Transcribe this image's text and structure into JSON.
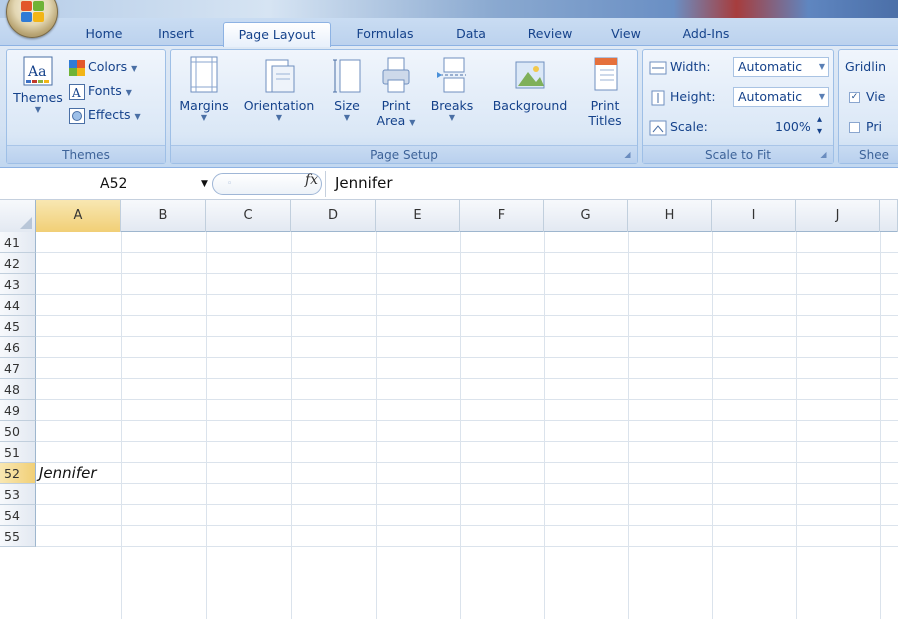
{
  "tabs": [
    {
      "label": "Home",
      "active": false
    },
    {
      "label": "Insert",
      "active": false
    },
    {
      "label": "Page Layout",
      "active": true
    },
    {
      "label": "Formulas",
      "active": false
    },
    {
      "label": "Data",
      "active": false
    },
    {
      "label": "Review",
      "active": false
    },
    {
      "label": "View",
      "active": false
    },
    {
      "label": "Add-Ins",
      "active": false
    }
  ],
  "ribbon": {
    "themes": {
      "group_label": "Themes",
      "themes_label": "Themes",
      "colors_label": "Colors",
      "fonts_label": "Fonts",
      "effects_label": "Effects"
    },
    "page_setup": {
      "group_label": "Page Setup",
      "margins_label": "Margins",
      "orientation_label": "Orientation",
      "size_label": "Size",
      "print_area_label_1": "Print",
      "print_area_label_2": "Area",
      "breaks_label": "Breaks",
      "background_label": "Background",
      "print_titles_label_1": "Print",
      "print_titles_label_2": "Titles"
    },
    "scale_to_fit": {
      "group_label": "Scale to Fit",
      "width_label": "Width:",
      "width_value": "Automatic",
      "height_label": "Height:",
      "height_value": "Automatic",
      "scale_label": "Scale:",
      "scale_value": "100%"
    },
    "sheet_options": {
      "group_label_partial": "Shee",
      "gridlines_label_partial": "Gridlin",
      "view_label_partial": "Vie",
      "print_label_partial": "Pri",
      "view_checked": true,
      "print_checked": false
    }
  },
  "formula_bar": {
    "name_box": "A52",
    "fx_label": "fx",
    "content": "Jennifer"
  },
  "grid": {
    "columns": [
      "A",
      "B",
      "C",
      "D",
      "E",
      "F",
      "G",
      "H",
      "I",
      "J"
    ],
    "selected_column": "A",
    "rows": [
      "41",
      "42",
      "43",
      "44",
      "45",
      "46",
      "47",
      "48",
      "49",
      "50",
      "51",
      "52",
      "53",
      "54",
      "55"
    ],
    "selected_row": "52",
    "cells": {
      "A52": "Jennifer"
    }
  },
  "colors": {
    "ribbon_text": "#15428b",
    "selected_header": "#f1cf76",
    "tab_strip": "#bcd2ee"
  }
}
